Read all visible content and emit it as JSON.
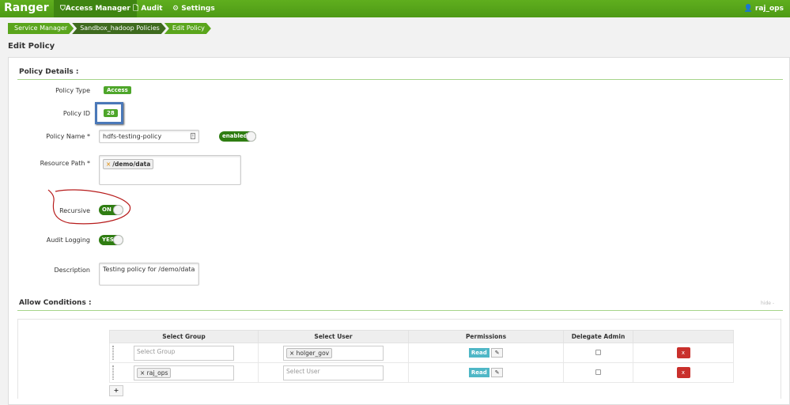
{
  "nav": {
    "brand": "Ranger",
    "items": [
      {
        "label": "Access Manager",
        "icon": "shield-icon"
      },
      {
        "label": "Audit",
        "icon": "file-icon"
      },
      {
        "label": "Settings",
        "icon": "gear-icon"
      }
    ],
    "user": "raj_ops"
  },
  "breadcrumb": [
    "Service Manager",
    "Sandbox_hadoop Policies",
    "Edit Policy"
  ],
  "page_title": "Edit Policy",
  "details": {
    "header": "Policy Details :",
    "policy_type_label": "Policy Type",
    "policy_type": "Access",
    "policy_id_label": "Policy ID",
    "policy_id": "28",
    "policy_name_label": "Policy Name *",
    "policy_name": "hdfs-testing-policy",
    "enabled": "enabled",
    "resource_path_label": "Resource Path *",
    "resource_path": "/demo/data",
    "recursive_label": "Recursive",
    "recursive": "ON",
    "audit_label": "Audit Logging",
    "audit": "YES",
    "description_label": "Description",
    "description": "Testing policy for /demo/data"
  },
  "allow": {
    "header": "Allow Conditions :",
    "hide": "hide -",
    "columns": [
      "Select Group",
      "Select User",
      "Permissions",
      "Delegate Admin"
    ],
    "group_placeholder": "Select Group",
    "user_placeholder": "Select User",
    "rows": [
      {
        "user": "holger_gov",
        "permission": "Read"
      },
      {
        "group": "raj_ops",
        "permission": "Read"
      }
    ],
    "add": "+",
    "delete": "x"
  },
  "colors": {
    "green": "#5aa51c",
    "annotation": "#b71c1c",
    "highlight": "#4a78b8"
  }
}
